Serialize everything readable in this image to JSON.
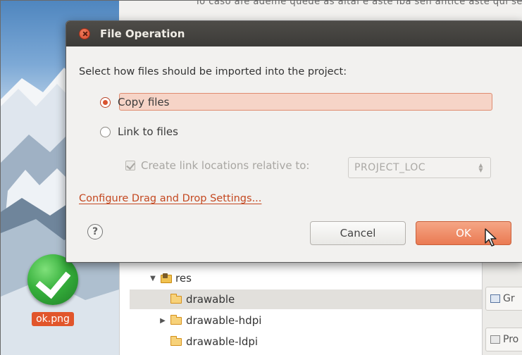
{
  "top_strip": {
    "partial_text": "lo caso afe ademe quede as altai  e aste iba sen antice aste qui sear a"
  },
  "desktop": {
    "icon_label": "ok.png",
    "icon": "check-icon"
  },
  "explorer": {
    "items": [
      {
        "label": "res",
        "arrow": "▼",
        "icon": "res-folder-icon"
      },
      {
        "label": "drawable",
        "arrow": "",
        "icon": "folder-icon",
        "selected": true
      },
      {
        "label": "drawable-hdpi",
        "arrow": "▶",
        "icon": "folder-icon"
      },
      {
        "label": "drawable-ldpi",
        "arrow": "",
        "icon": "folder-icon"
      }
    ]
  },
  "right_panel": {
    "tab1": "Gr",
    "tab2": "Pro"
  },
  "dialog": {
    "title": "File Operation",
    "prompt": "Select how files should be imported into the project:",
    "options": [
      {
        "label": "Copy files",
        "checked": true
      },
      {
        "label": "Link to files",
        "checked": false
      }
    ],
    "relative_checkbox": {
      "label": "Create link locations relative to:",
      "checked": true,
      "disabled": true
    },
    "location_select": {
      "value": "PROJECT_LOC"
    },
    "config_link": "Configure Drag and Drop Settings...",
    "help_symbol": "?",
    "cancel_label": "Cancel",
    "ok_label": "OK"
  },
  "colors": {
    "accent": "#ea7a52",
    "link": "#c44820",
    "titlebar": "#3c3b38"
  }
}
